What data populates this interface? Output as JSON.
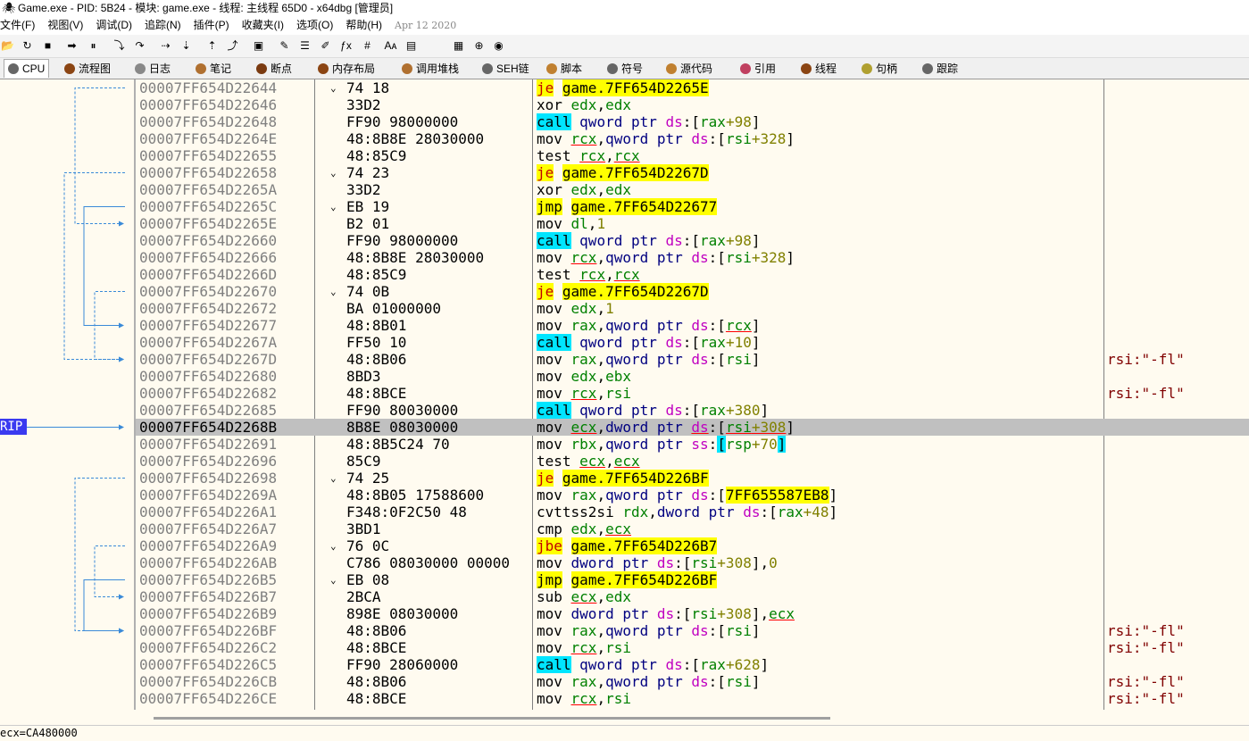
{
  "title": "Game.exe - PID: 5B24 - 模块: game.exe - 线程: 主线程 65D0 - x64dbg [管理员]",
  "menu": [
    "文件(F)",
    "视图(V)",
    "调试(D)",
    "追踪(N)",
    "插件(P)",
    "收藏夹(I)",
    "选项(O)",
    "帮助(H)"
  ],
  "build_date": "Apr 12 2020",
  "toolbar_icons": [
    "open-icon",
    "restart-icon",
    "stop-icon",
    "run-icon",
    "pause-icon",
    "step-into-icon",
    "step-over-icon",
    "trace-into-icon",
    "trace-over-icon",
    "execute-till-return-icon",
    "run-to-user-code-icon",
    "patch-icon",
    "comment-icon",
    "label-icon",
    "bookmark-icon",
    "function-icon",
    "highlight-icon",
    "strings-icon",
    "hash-icon",
    "font-icon",
    "calculator-icon",
    "log-icon"
  ],
  "toolbar_glyphs": [
    "📂",
    "↻",
    "■",
    "➡",
    "⏸",
    "⤵",
    "↷",
    "⇢",
    "⇣",
    "⇡",
    "⤴",
    "▣",
    "✎",
    "☰",
    "✐",
    "ƒx",
    "#",
    "Aᴀ",
    "▤",
    "▦",
    "⊕",
    "◉"
  ],
  "tabs": [
    {
      "label": "CPU",
      "icon": "cpu-icon",
      "color": "#666"
    },
    {
      "label": "流程图",
      "icon": "graph-icon",
      "color": "#8b4513"
    },
    {
      "label": "日志",
      "icon": "log-icon",
      "color": "#888"
    },
    {
      "label": "笔记",
      "icon": "notes-icon",
      "color": "#b07030"
    },
    {
      "label": "断点",
      "icon": "breakpoint-icon",
      "color": "#7a3a10"
    },
    {
      "label": "内存布局",
      "icon": "memory-map-icon",
      "color": "#8b4513"
    },
    {
      "label": "调用堆栈",
      "icon": "call-stack-icon",
      "color": "#b07030"
    },
    {
      "label": "SEH链",
      "icon": "seh-icon",
      "color": "#666"
    },
    {
      "label": "脚本",
      "icon": "script-icon",
      "color": "#c08030"
    },
    {
      "label": "符号",
      "icon": "symbols-icon",
      "color": "#666"
    },
    {
      "label": "源代码",
      "icon": "source-icon",
      "color": "#c08030"
    },
    {
      "label": "引用",
      "icon": "references-icon",
      "color": "#c04060"
    },
    {
      "label": "线程",
      "icon": "threads-icon",
      "color": "#8b4513"
    },
    {
      "label": "句柄",
      "icon": "handles-icon",
      "color": "#b0a030"
    },
    {
      "label": "跟踪",
      "icon": "trace-icon",
      "color": "#666"
    }
  ],
  "rip_label": "RIP",
  "rows": [
    {
      "addr": "00007FF654D22644",
      "bytes": "74 18",
      "jmp": true,
      "instr": [
        [
          "je",
          "kw-je"
        ],
        [
          " "
        ],
        [
          "game.7FF654D2265E",
          "tgt"
        ]
      ]
    },
    {
      "addr": "00007FF654D22646",
      "bytes": "33D2",
      "instr": [
        [
          "xor "
        ],
        [
          "edx",
          "reg"
        ],
        [
          ","
        ],
        [
          "edx",
          "reg"
        ]
      ]
    },
    {
      "addr": "00007FF654D22648",
      "bytes": "FF90 98000000",
      "instr": [
        [
          "call",
          "kw-call"
        ],
        [
          " "
        ],
        [
          "qword ptr ",
          "ptr"
        ],
        [
          "ds",
          "seg"
        ],
        [
          ":["
        ],
        [
          "rax",
          "reg"
        ],
        [
          "+98",
          "num"
        ],
        [
          "]"
        ]
      ]
    },
    {
      "addr": "00007FF654D2264E",
      "bytes": "48:8B8E 28030000",
      "instr": [
        [
          "mov "
        ],
        [
          "rcx",
          "reg ul"
        ],
        [
          ","
        ],
        [
          "qword ptr ",
          "ptr"
        ],
        [
          "ds",
          "seg"
        ],
        [
          ":["
        ],
        [
          "rsi",
          "reg"
        ],
        [
          "+328",
          "num"
        ],
        [
          "]"
        ]
      ]
    },
    {
      "addr": "00007FF654D22655",
      "bytes": "48:85C9",
      "instr": [
        [
          "test "
        ],
        [
          "rcx",
          "reg ul"
        ],
        [
          ","
        ],
        [
          "rcx",
          "reg ul"
        ]
      ]
    },
    {
      "addr": "00007FF654D22658",
      "bytes": "74 23",
      "jmp": true,
      "instr": [
        [
          "je",
          "kw-je"
        ],
        [
          " "
        ],
        [
          "game.7FF654D2267D",
          "tgt"
        ]
      ]
    },
    {
      "addr": "00007FF654D2265A",
      "bytes": "33D2",
      "instr": [
        [
          "xor "
        ],
        [
          "edx",
          "reg"
        ],
        [
          ","
        ],
        [
          "edx",
          "reg"
        ]
      ]
    },
    {
      "addr": "00007FF654D2265C",
      "bytes": "EB 19",
      "jmp": true,
      "instr": [
        [
          "jmp",
          "tgt"
        ],
        [
          " "
        ],
        [
          "game.7FF654D22677",
          "tgt"
        ]
      ]
    },
    {
      "addr": "00007FF654D2265E",
      "bytes": "B2 01",
      "instr": [
        [
          "mov "
        ],
        [
          "dl",
          "reg"
        ],
        [
          ","
        ],
        [
          "1",
          "num"
        ]
      ]
    },
    {
      "addr": "00007FF654D22660",
      "bytes": "FF90 98000000",
      "instr": [
        [
          "call",
          "kw-call"
        ],
        [
          " "
        ],
        [
          "qword ptr ",
          "ptr"
        ],
        [
          "ds",
          "seg"
        ],
        [
          ":["
        ],
        [
          "rax",
          "reg"
        ],
        [
          "+98",
          "num"
        ],
        [
          "]"
        ]
      ]
    },
    {
      "addr": "00007FF654D22666",
      "bytes": "48:8B8E 28030000",
      "instr": [
        [
          "mov "
        ],
        [
          "rcx",
          "reg ul"
        ],
        [
          ","
        ],
        [
          "qword ptr ",
          "ptr"
        ],
        [
          "ds",
          "seg"
        ],
        [
          ":["
        ],
        [
          "rsi",
          "reg"
        ],
        [
          "+328",
          "num"
        ],
        [
          "]"
        ]
      ]
    },
    {
      "addr": "00007FF654D2266D",
      "bytes": "48:85C9",
      "instr": [
        [
          "test "
        ],
        [
          "rcx",
          "reg ul"
        ],
        [
          ","
        ],
        [
          "rcx",
          "reg ul"
        ]
      ]
    },
    {
      "addr": "00007FF654D22670",
      "bytes": "74 0B",
      "jmp": true,
      "instr": [
        [
          "je",
          "kw-je"
        ],
        [
          " "
        ],
        [
          "game.7FF654D2267D",
          "tgt"
        ]
      ]
    },
    {
      "addr": "00007FF654D22672",
      "bytes": "BA 01000000",
      "instr": [
        [
          "mov "
        ],
        [
          "edx",
          "reg"
        ],
        [
          ","
        ],
        [
          "1",
          "num"
        ]
      ]
    },
    {
      "addr": "00007FF654D22677",
      "bytes": "48:8B01",
      "instr": [
        [
          "mov "
        ],
        [
          "rax",
          "reg"
        ],
        [
          ","
        ],
        [
          "qword ptr ",
          "ptr"
        ],
        [
          "ds",
          "seg"
        ],
        [
          ":["
        ],
        [
          "rcx",
          "reg ul"
        ],
        [
          "]"
        ]
      ]
    },
    {
      "addr": "00007FF654D2267A",
      "bytes": "FF50 10",
      "instr": [
        [
          "call",
          "kw-call"
        ],
        [
          " "
        ],
        [
          "qword ptr ",
          "ptr"
        ],
        [
          "ds",
          "seg"
        ],
        [
          ":["
        ],
        [
          "rax",
          "reg"
        ],
        [
          "+10",
          "num"
        ],
        [
          "]"
        ]
      ]
    },
    {
      "addr": "00007FF654D2267D",
      "bytes": "48:8B06",
      "instr": [
        [
          "mov "
        ],
        [
          "rax",
          "reg"
        ],
        [
          ","
        ],
        [
          "qword ptr ",
          "ptr"
        ],
        [
          "ds",
          "seg"
        ],
        [
          ":["
        ],
        [
          "rsi",
          "reg"
        ],
        [
          "]"
        ]
      ],
      "comment": "rsi:\"-fl\""
    },
    {
      "addr": "00007FF654D22680",
      "bytes": "8BD3",
      "instr": [
        [
          "mov "
        ],
        [
          "edx",
          "reg"
        ],
        [
          ","
        ],
        [
          "ebx",
          "reg"
        ]
      ]
    },
    {
      "addr": "00007FF654D22682",
      "bytes": "48:8BCE",
      "instr": [
        [
          "mov "
        ],
        [
          "rcx",
          "reg ul"
        ],
        [
          ","
        ],
        [
          "rsi",
          "reg"
        ]
      ],
      "comment": "rsi:\"-fl\""
    },
    {
      "addr": "00007FF654D22685",
      "bytes": "FF90 80030000",
      "instr": [
        [
          "call",
          "kw-call"
        ],
        [
          " "
        ],
        [
          "qword ptr ",
          "ptr"
        ],
        [
          "ds",
          "seg"
        ],
        [
          ":["
        ],
        [
          "rax",
          "reg"
        ],
        [
          "+380",
          "num"
        ],
        [
          "]"
        ]
      ]
    },
    {
      "addr": "00007FF654D2268B",
      "bytes": "8B8E 08030000",
      "rip": true,
      "instr": [
        [
          "mov "
        ],
        [
          "ecx",
          "reg ul"
        ],
        [
          ","
        ],
        [
          "dword ptr ",
          "ptr"
        ],
        [
          "ds",
          "seg ul"
        ],
        [
          ":["
        ],
        [
          "rsi",
          "reg ul"
        ],
        [
          "+308",
          "num ul"
        ],
        [
          "]"
        ]
      ]
    },
    {
      "addr": "00007FF654D22691",
      "bytes": "48:8B5C24 70",
      "instr": [
        [
          "mov "
        ],
        [
          "rbx",
          "reg"
        ],
        [
          ","
        ],
        [
          "qword ptr ",
          "ptr"
        ],
        [
          "ss",
          "seg"
        ],
        [
          ":"
        ],
        [
          "[",
          "kw-call"
        ],
        [
          "rsp",
          "reg"
        ],
        [
          "+70",
          "num"
        ],
        [
          "]",
          "kw-call"
        ]
      ]
    },
    {
      "addr": "00007FF654D22696",
      "bytes": "85C9",
      "instr": [
        [
          "test "
        ],
        [
          "ecx",
          "reg ul"
        ],
        [
          ","
        ],
        [
          "ecx",
          "reg ul"
        ]
      ]
    },
    {
      "addr": "00007FF654D22698",
      "bytes": "74 25",
      "jmp": true,
      "instr": [
        [
          "je",
          "kw-je"
        ],
        [
          " "
        ],
        [
          "game.7FF654D226BF",
          "tgt"
        ]
      ]
    },
    {
      "addr": "00007FF654D2269A",
      "bytes": "48:8B05 17588600",
      "instr": [
        [
          "mov "
        ],
        [
          "rax",
          "reg"
        ],
        [
          ","
        ],
        [
          "qword ptr ",
          "ptr"
        ],
        [
          "ds",
          "seg"
        ],
        [
          ":["
        ],
        [
          "7FF655587EB8",
          "tgt"
        ],
        [
          "]"
        ]
      ]
    },
    {
      "addr": "00007FF654D226A1",
      "bytes": "F348:0F2C50 48",
      "instr": [
        [
          "cvttss2si "
        ],
        [
          "rdx",
          "reg"
        ],
        [
          ","
        ],
        [
          "dword ptr ",
          "ptr"
        ],
        [
          "ds",
          "seg"
        ],
        [
          ":["
        ],
        [
          "rax",
          "reg"
        ],
        [
          "+48",
          "num"
        ],
        [
          "]"
        ]
      ]
    },
    {
      "addr": "00007FF654D226A7",
      "bytes": "3BD1",
      "instr": [
        [
          "cmp "
        ],
        [
          "edx",
          "reg"
        ],
        [
          ","
        ],
        [
          "ecx",
          "reg ul"
        ]
      ]
    },
    {
      "addr": "00007FF654D226A9",
      "bytes": "76 0C",
      "jmp": true,
      "instr": [
        [
          "jbe",
          "kw-je"
        ],
        [
          " "
        ],
        [
          "game.7FF654D226B7",
          "tgt"
        ]
      ]
    },
    {
      "addr": "00007FF654D226AB",
      "bytes": "C786 08030000 00000",
      "instr": [
        [
          "mov "
        ],
        [
          "dword ptr ",
          "ptr"
        ],
        [
          "ds",
          "seg"
        ],
        [
          ":["
        ],
        [
          "rsi",
          "reg"
        ],
        [
          "+308",
          "num"
        ],
        [
          "],"
        ],
        [
          "0",
          "num"
        ]
      ]
    },
    {
      "addr": "00007FF654D226B5",
      "bytes": "EB 08",
      "jmp": true,
      "instr": [
        [
          "jmp",
          "tgt"
        ],
        [
          " "
        ],
        [
          "game.7FF654D226BF",
          "tgt"
        ]
      ]
    },
    {
      "addr": "00007FF654D226B7",
      "bytes": "2BCA",
      "instr": [
        [
          "sub "
        ],
        [
          "ecx",
          "reg ul"
        ],
        [
          ","
        ],
        [
          "edx",
          "reg"
        ]
      ]
    },
    {
      "addr": "00007FF654D226B9",
      "bytes": "898E 08030000",
      "instr": [
        [
          "mov "
        ],
        [
          "dword ptr ",
          "ptr"
        ],
        [
          "ds",
          "seg"
        ],
        [
          ":["
        ],
        [
          "rsi",
          "reg"
        ],
        [
          "+308",
          "num"
        ],
        [
          "],"
        ],
        [
          "ecx",
          "reg ul"
        ]
      ]
    },
    {
      "addr": "00007FF654D226BF",
      "bytes": "48:8B06",
      "instr": [
        [
          "mov "
        ],
        [
          "rax",
          "reg"
        ],
        [
          ","
        ],
        [
          "qword ptr ",
          "ptr"
        ],
        [
          "ds",
          "seg"
        ],
        [
          ":["
        ],
        [
          "rsi",
          "reg"
        ],
        [
          "]"
        ]
      ],
      "comment": "rsi:\"-fl\""
    },
    {
      "addr": "00007FF654D226C2",
      "bytes": "48:8BCE",
      "instr": [
        [
          "mov "
        ],
        [
          "rcx",
          "reg ul"
        ],
        [
          ","
        ],
        [
          "rsi",
          "reg"
        ]
      ],
      "comment": "rsi:\"-fl\""
    },
    {
      "addr": "00007FF654D226C5",
      "bytes": "FF90 28060000",
      "instr": [
        [
          "call",
          "kw-call"
        ],
        [
          " "
        ],
        [
          "qword ptr ",
          "ptr"
        ],
        [
          "ds",
          "seg"
        ],
        [
          ":["
        ],
        [
          "rax",
          "reg"
        ],
        [
          "+628",
          "num"
        ],
        [
          "]"
        ]
      ]
    },
    {
      "addr": "00007FF654D226CB",
      "bytes": "48:8B06",
      "instr": [
        [
          "mov "
        ],
        [
          "rax",
          "reg"
        ],
        [
          ","
        ],
        [
          "qword ptr ",
          "ptr"
        ],
        [
          "ds",
          "seg"
        ],
        [
          ":["
        ],
        [
          "rsi",
          "reg"
        ],
        [
          "]"
        ]
      ],
      "comment": "rsi:\"-fl\""
    },
    {
      "addr": "00007FF654D226CE",
      "bytes": "48:8BCE",
      "instr": [
        [
          "mov "
        ],
        [
          "rcx",
          "reg ul"
        ],
        [
          ","
        ],
        [
          "rsi",
          "reg"
        ]
      ],
      "comment": "rsi:\"-fl\""
    }
  ],
  "status_text": "ecx=CA480000",
  "colors": {
    "rip_bg": "#3a3af0",
    "highlight_row": "#c0c0c0",
    "jump_bg": "#ffff00",
    "call_bg": "#00e5ff"
  }
}
